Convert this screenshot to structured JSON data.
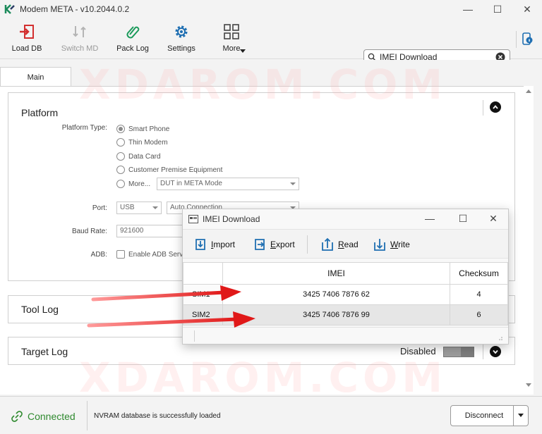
{
  "window": {
    "title": "Modem META - v10.2044.0.2",
    "controls": {
      "minimize": "—",
      "maximize": "☐",
      "close": "✕"
    }
  },
  "toolbar": {
    "items": [
      {
        "label": "Load DB",
        "icon": "load-db-icon",
        "enabled": true
      },
      {
        "label": "Switch MD",
        "icon": "switch-md-icon",
        "enabled": false
      },
      {
        "label": "Pack Log",
        "icon": "paperclip-icon",
        "enabled": true
      },
      {
        "label": "Settings",
        "icon": "gear-icon",
        "enabled": true
      },
      {
        "label": "More",
        "icon": "grid-icon",
        "enabled": true
      }
    ],
    "search_value": "IMEI Download"
  },
  "tabs": [
    {
      "label": "Main",
      "active": true
    }
  ],
  "platform": {
    "title": "Platform",
    "platform_type_label": "Platform Type:",
    "options": [
      "Smart Phone",
      "Thin Modem",
      "Data Card",
      "Customer Premise Equipment",
      "More..."
    ],
    "selected_option": "Smart Phone",
    "more_select_value": "DUT in META Mode",
    "port_label": "Port:",
    "port_value": "USB",
    "port_mode_value": "Auto Connection",
    "baud_label": "Baud Rate:",
    "baud_value": "921600",
    "adb_label": "ADB:",
    "adb_checkbox_label": "Enable ADB Servi"
  },
  "tool_log": {
    "title": "Tool Log"
  },
  "target_log": {
    "title": "Target Log",
    "toggle_label": "Disabled",
    "toggle_on": false
  },
  "status": {
    "connection": "Connected",
    "message": "NVRAM database is successfully loaded",
    "disconnect_label": "Disconnect"
  },
  "imei_dialog": {
    "title": "IMEI Download",
    "buttons": [
      {
        "prefix": "",
        "underlined": "I",
        "rest": "mport",
        "icon": "import-icon"
      },
      {
        "prefix": "",
        "underlined": "E",
        "rest": "xport",
        "icon": "export-icon"
      },
      {
        "prefix": "",
        "underlined": "R",
        "rest": "ead",
        "icon": "read-icon"
      },
      {
        "prefix": "",
        "underlined": "W",
        "rest": "rite",
        "icon": "write-icon"
      }
    ],
    "columns": [
      "",
      "IMEI",
      "Checksum"
    ],
    "rows": [
      {
        "slot": "SIM1",
        "imei": "3425 7406 7876 62",
        "checksum": "4"
      },
      {
        "slot": "SIM2",
        "imei": "3425 7406 7876 99",
        "checksum": "6"
      }
    ],
    "selected_row": 1
  },
  "watermark": "XDAROM.COM",
  "colors": {
    "accent": "#d32f2f",
    "toolbar_icon_blue": "#1f6fb2",
    "connected_green": "#2f8a2f",
    "arrow_red": "#e01818"
  }
}
